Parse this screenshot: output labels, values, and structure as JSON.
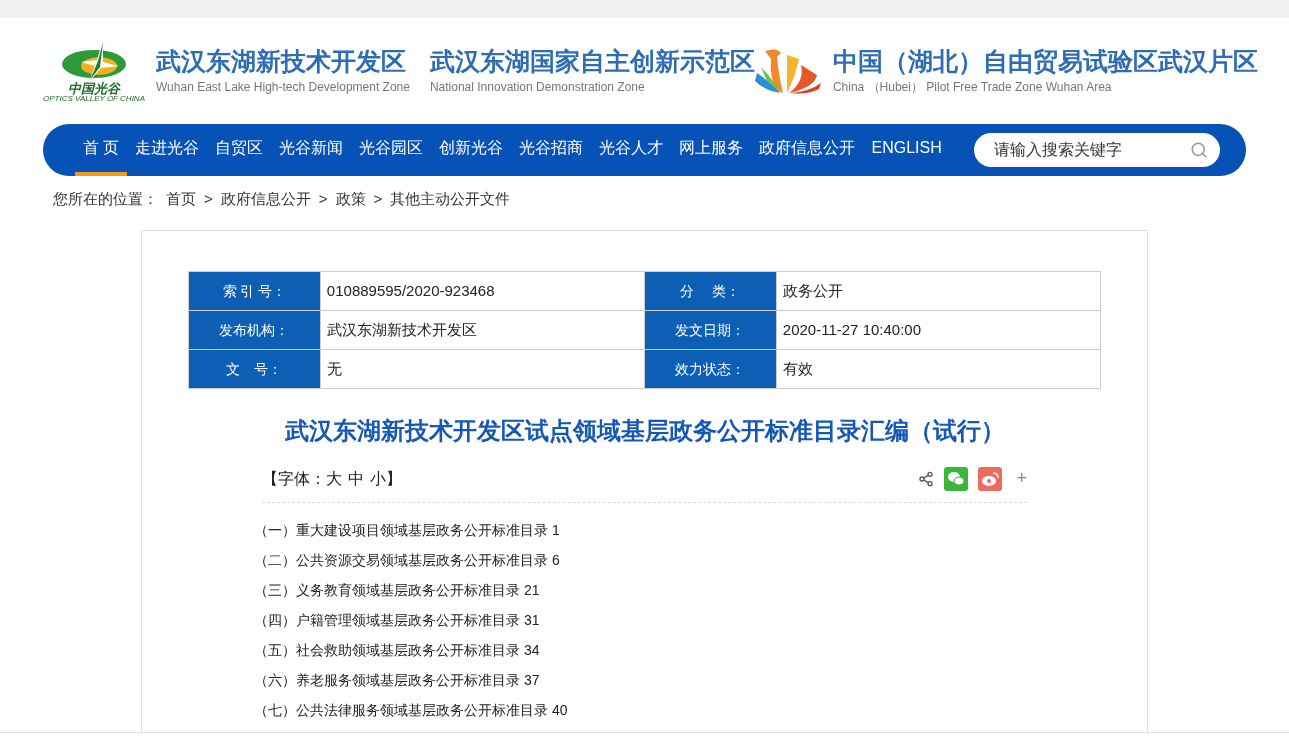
{
  "header": {
    "brands": [
      {
        "kind": "optics",
        "logo_text": "中国光谷",
        "logo_sub": "OPTICS VALLEY OF CHINA",
        "title": "武汉东湖新技术开发区",
        "subtitle": "Wuhan East Lake High-tech Development Zone"
      },
      {
        "kind": "plain",
        "title": "武汉东湖国家自主创新示范区",
        "subtitle": "National Innovation Demonstration Zone"
      },
      {
        "kind": "ftz",
        "title": "中国（湖北）自由贸易试验区武汉片区",
        "subtitle": "China （Hubei） Pilot Free Trade Zone Wuhan Area"
      }
    ]
  },
  "nav": {
    "items": [
      {
        "label": "首 页",
        "selected": true
      },
      {
        "label": "走进光谷",
        "selected": false
      },
      {
        "label": "自贸区",
        "selected": false
      },
      {
        "label": "光谷新闻",
        "selected": false
      },
      {
        "label": "光谷园区",
        "selected": false
      },
      {
        "label": "创新光谷",
        "selected": false
      },
      {
        "label": "光谷招商",
        "selected": false
      },
      {
        "label": "光谷人才",
        "selected": false
      },
      {
        "label": "网上服务",
        "selected": false
      },
      {
        "label": "政府信息公开",
        "selected": false
      },
      {
        "label": "ENGLISH",
        "selected": false
      }
    ],
    "search": {
      "placeholder": "请输入搜索关键字"
    }
  },
  "breadcrumb": {
    "label": "您所在的位置：",
    "items": [
      "首页",
      "政府信息公开",
      "政策",
      "其他主动公开文件"
    ],
    "separator": ">"
  },
  "meta_table": {
    "rows": [
      [
        {
          "label": "索 引 号：",
          "value": "010889595/2020-923468"
        },
        {
          "label": "分　 类：",
          "value": "政务公开"
        }
      ],
      [
        {
          "label": "发布机构：",
          "value": "武汉东湖新技术开发区"
        },
        {
          "label": "发文日期：",
          "value": "2020-11-27 10:40:00"
        }
      ],
      [
        {
          "label": "文　号：",
          "value": "无"
        },
        {
          "label": "效力状态：",
          "value": "有效"
        }
      ]
    ]
  },
  "article": {
    "title": "武汉东湖新技术开发区试点领域基层政务公开标准目录汇编（试行）",
    "font_size": {
      "open": "【字体：",
      "sizes": [
        "大",
        "中",
        "小"
      ],
      "close": "】"
    },
    "share_more": "+",
    "contents": [
      "（一）重大建设项目领域基层政务公开标准目录 1",
      "（二）公共资源交易领域基层政务公开标准目录 6",
      "（三）义务教育领域基层政务公开标准目录 21",
      "（四）户籍管理领域基层政务公开标准目录 31",
      "（五）社会救助领域基层政务公开标准目录 34",
      "（六）养老服务领域基层政务公开标准目录 37",
      "（七）公共法律服务领域基层政务公开标准目录 40"
    ]
  }
}
